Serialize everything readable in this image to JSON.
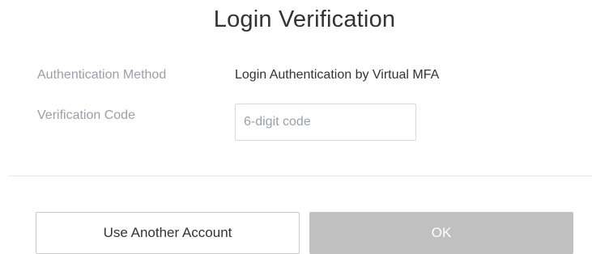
{
  "dialog": {
    "title": "Login Verification",
    "method_label": "Authentication Method",
    "method_value": "Login Authentication by Virtual MFA",
    "code_label": "Verification Code",
    "code_value": "",
    "code_placeholder": "6-digit code",
    "secondary_button_label": "Use Another Account",
    "primary_button_label": "OK",
    "primary_button_state": "disabled"
  },
  "colors": {
    "label": "#9aa0aa",
    "text": "#333333",
    "disabled_button": "#c0c0c0",
    "border": "#c8ccd3"
  }
}
